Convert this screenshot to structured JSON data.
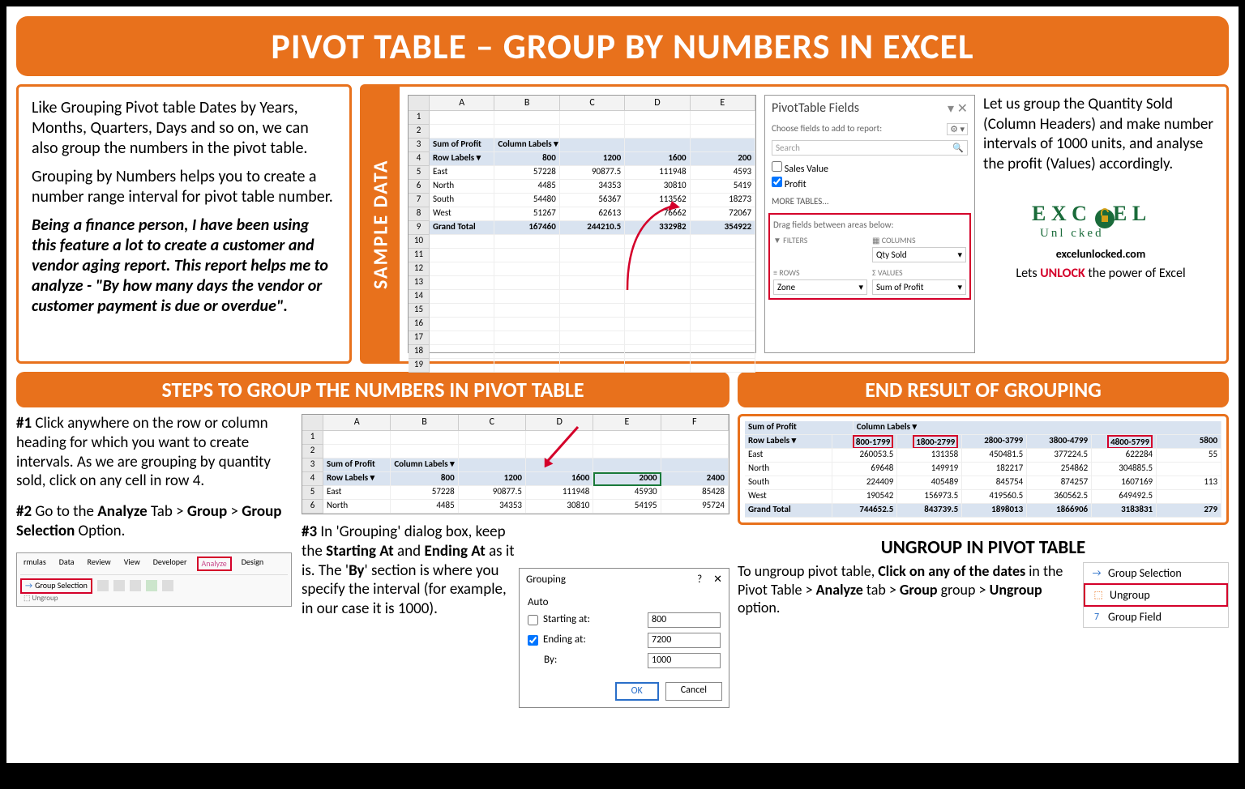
{
  "title": "PIVOT TABLE – GROUP BY NUMBERS IN EXCEL",
  "intro": {
    "p1": "Like Grouping Pivot table Dates by Years, Months, Quarters, Days and so on, we can also group the numbers in the pivot table.",
    "p2": "Grouping by Numbers helps you to create a number range interval for pivot table number.",
    "p3": "Being a finance person, I have been using this feature a lot to create a customer and vendor aging report. This report helps me to analyze - \"By how many days the vendor or customer payment is due or overdue\"."
  },
  "sample_label": "SAMPLE DATA",
  "sample_sheet": {
    "cols": [
      "A",
      "B",
      "C",
      "D",
      "E"
    ],
    "rows": [
      {
        "n": "1",
        "cells": [
          "",
          "",
          "",
          "",
          ""
        ]
      },
      {
        "n": "2",
        "cells": [
          "",
          "",
          "",
          "",
          ""
        ]
      },
      {
        "n": "3",
        "cells": [
          "Sum of Profit",
          "Column Labels ▾",
          "",
          "",
          ""
        ],
        "hdr": true
      },
      {
        "n": "4",
        "cells": [
          "Row Labels ▾",
          "800",
          "1200",
          "1600",
          "200"
        ],
        "hdr": true
      },
      {
        "n": "5",
        "cells": [
          "East",
          "57228",
          "90877.5",
          "111948",
          "4593"
        ]
      },
      {
        "n": "6",
        "cells": [
          "North",
          "4485",
          "34353",
          "30810",
          "5419"
        ]
      },
      {
        "n": "7",
        "cells": [
          "South",
          "54480",
          "56367",
          "113562",
          "18273"
        ]
      },
      {
        "n": "8",
        "cells": [
          "West",
          "51267",
          "62613",
          "76662",
          "72067"
        ]
      },
      {
        "n": "9",
        "cells": [
          "Grand Total",
          "167460",
          "244210.5",
          "332982",
          "354922"
        ],
        "hdr": true
      },
      {
        "n": "10",
        "cells": [
          "",
          "",
          "",
          "",
          ""
        ]
      },
      {
        "n": "11",
        "cells": [
          "",
          "",
          "",
          "",
          ""
        ]
      },
      {
        "n": "12",
        "cells": [
          "",
          "",
          "",
          "",
          ""
        ]
      },
      {
        "n": "13",
        "cells": [
          "",
          "",
          "",
          "",
          ""
        ]
      },
      {
        "n": "14",
        "cells": [
          "",
          "",
          "",
          "",
          ""
        ]
      },
      {
        "n": "15",
        "cells": [
          "",
          "",
          "",
          "",
          ""
        ]
      },
      {
        "n": "16",
        "cells": [
          "",
          "",
          "",
          "",
          ""
        ]
      },
      {
        "n": "17",
        "cells": [
          "",
          "",
          "",
          "",
          ""
        ]
      },
      {
        "n": "18",
        "cells": [
          "",
          "",
          "",
          "",
          ""
        ]
      },
      {
        "n": "19",
        "cells": [
          "",
          "",
          "",
          "",
          ""
        ]
      }
    ]
  },
  "fields": {
    "title": "PivotTable Fields",
    "sub": "Choose fields to add to report:",
    "search": "Search",
    "list": [
      "Sales Value",
      "Profit"
    ],
    "checked": [
      false,
      true
    ],
    "more": "MORE TABLES...",
    "areas_title": "Drag fields between areas below:",
    "filters": "FILTERS",
    "columns": "COLUMNS",
    "rows": "ROWS",
    "values": "VALUES",
    "col_val": "Qty Sold",
    "row_val": "Zone",
    "val_val": "Sum of Profit"
  },
  "right_note": "Let us group the Quantity Sold (Column Headers) and make number intervals of 1000 units, and analyse the profit (Values) accordingly.",
  "logo": {
    "site": "excelunlocked.com",
    "tag_pre": "Lets ",
    "tag_unlock": "UNLOCK",
    "tag_post": " the power of Excel"
  },
  "steps_title": "STEPS TO GROUP THE NUMBERS IN PIVOT TABLE",
  "step1_num": "#1",
  "step1": " Click anywhere on the row or column heading for which you want to create intervals. As we are grouping by quantity sold, click on any cell in row 4.",
  "step2_num": "#2",
  "step2_a": " Go to the ",
  "step2_b": "Analyze",
  "step2_c": " Tab > ",
  "step2_d": "Group",
  "step2_e": " > ",
  "step2_f": "Group Selection",
  "step2_g": " Option.",
  "ribbon": {
    "tabs": [
      "rmulas",
      "Data",
      "Review",
      "View",
      "Developer",
      "Analyze",
      "Design"
    ],
    "group_selection": "Group Selection",
    "ungroup": "Ungroup"
  },
  "mid_sheet": {
    "cols": [
      "A",
      "B",
      "C",
      "D",
      "E",
      "F"
    ],
    "rows": [
      {
        "n": "1",
        "cells": [
          "",
          "",
          "",
          "",
          "",
          ""
        ]
      },
      {
        "n": "2",
        "cells": [
          "",
          "",
          "",
          "",
          "",
          ""
        ]
      },
      {
        "n": "3",
        "cells": [
          "Sum of Profit",
          "Column Labels ▾",
          "",
          "",
          "",
          ""
        ],
        "hdr": true
      },
      {
        "n": "4",
        "cells": [
          "Row Labels ▾",
          "800",
          "1200",
          "1600",
          "2000",
          "2400"
        ],
        "hdr": true,
        "sel": 4
      },
      {
        "n": "5",
        "cells": [
          "East",
          "57228",
          "90877.5",
          "111948",
          "45930",
          "85428"
        ]
      },
      {
        "n": "6",
        "cells": [
          "North",
          "4485",
          "34353",
          "30810",
          "54195",
          "95724"
        ]
      }
    ]
  },
  "step3_num": "#3",
  "step3_a": " In 'Grouping' dialog box, keep the ",
  "step3_b": "Starting At",
  "step3_c": " and ",
  "step3_d": "Ending At",
  "step3_e": " as it is. The '",
  "step3_f": "By",
  "step3_g": "' section is where you specify the interval (for example, in our case it is 1000).",
  "dialog": {
    "title": "Grouping",
    "auto": "Auto",
    "starting": "Starting at:",
    "ending": "Ending at:",
    "by": "By:",
    "start_val": "800",
    "end_val": "7200",
    "by_val": "1000",
    "ok": "OK",
    "cancel": "Cancel"
  },
  "result_title": "END RESULT OF GROUPING",
  "result_sheet": {
    "header1": "Sum of Profit",
    "header1b": "Column Labels ▾",
    "header2": "Row Labels ▾",
    "groups": [
      "800-1799",
      "1800-2799",
      "2800-3799",
      "3800-4799",
      "4800-5799",
      "5800"
    ],
    "rows": [
      {
        "label": "East",
        "vals": [
          "260053.5",
          "131358",
          "450481.5",
          "377224.5",
          "622284",
          "55"
        ]
      },
      {
        "label": "North",
        "vals": [
          "69648",
          "149919",
          "182217",
          "254862",
          "304885.5",
          ""
        ]
      },
      {
        "label": "South",
        "vals": [
          "224409",
          "405489",
          "845754",
          "874257",
          "1607169",
          "113"
        ]
      },
      {
        "label": "West",
        "vals": [
          "190542",
          "156973.5",
          "419560.5",
          "360562.5",
          "649492.5",
          ""
        ]
      },
      {
        "label": "Grand Total",
        "vals": [
          "744652.5",
          "843739.5",
          "1898013",
          "1866906",
          "3183831",
          "279"
        ]
      }
    ]
  },
  "ungroup": {
    "title": "UNGROUP IN PIVOT TABLE",
    "t1": "To ungroup pivot table, ",
    "t2": "Click on any of the dates",
    "t3": " in the Pivot Table > ",
    "t4": "Analyze",
    "t5": " tab > ",
    "t6": "Group",
    "t7": " group > ",
    "t8": "Ungroup",
    "t9": " option.",
    "menu": [
      "Group Selection",
      "Ungroup",
      "Group Field"
    ]
  }
}
